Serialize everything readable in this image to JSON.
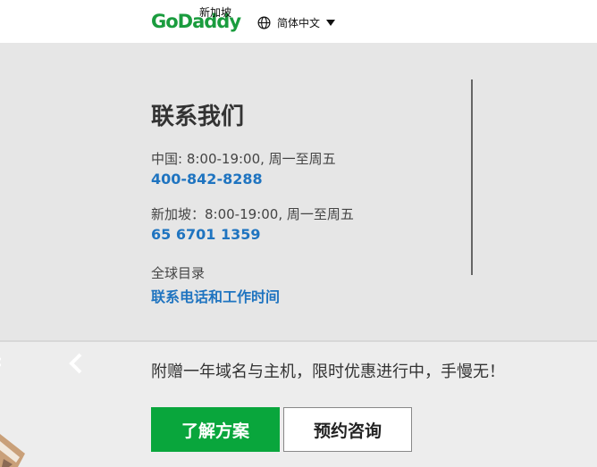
{
  "header": {
    "logo_text": "GoDaddy",
    "logo_region": "新加坡",
    "language": "简体中文"
  },
  "contact": {
    "title": "联系我们",
    "china_hours": "中国: 8:00-19:00, 周一至周五",
    "china_phone": "400-842-8288",
    "sg_hours": "新加坡：8:00-19:00, 周一至周五",
    "sg_phone": "65 6701 1359",
    "global_label": "全球目录",
    "global_link": "联系电话和工作时间"
  },
  "promo": {
    "text": "附赠一年域名与主机，限时优惠进行中，手慢无！",
    "primary_button": "了解方案",
    "secondary_button": "预约咨询"
  },
  "colors": {
    "brand_green": "#1a9c3e",
    "link_blue": "#1f74c0",
    "button_green": "#09a63c"
  }
}
